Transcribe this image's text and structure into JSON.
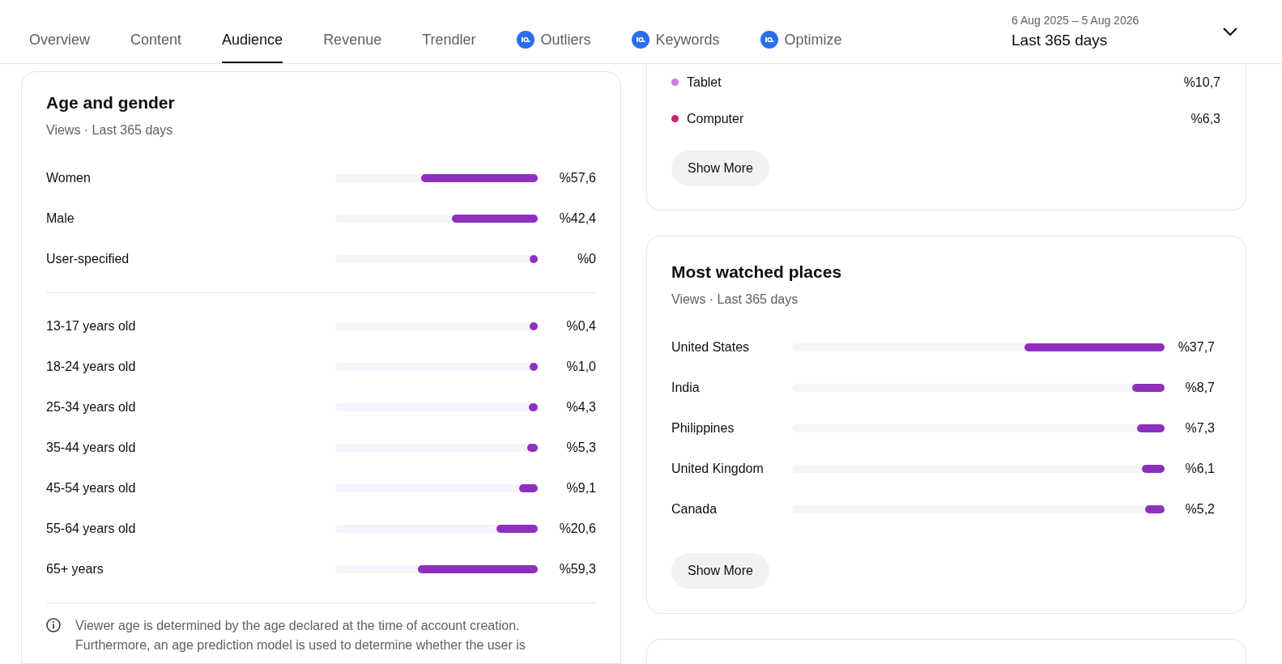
{
  "tabs": [
    {
      "label": "Overview",
      "selected": false,
      "kind": "plain"
    },
    {
      "label": "Content",
      "selected": false,
      "kind": "plain"
    },
    {
      "label": "Audience",
      "selected": true,
      "kind": "plain"
    },
    {
      "label": "Revenue",
      "selected": false,
      "kind": "plain"
    },
    {
      "label": "Trendler",
      "selected": false,
      "kind": "plain"
    },
    {
      "label": "Outliers",
      "selected": false,
      "kind": "tool"
    },
    {
      "label": "Keywords",
      "selected": false,
      "kind": "tool"
    },
    {
      "label": "Optimize",
      "selected": false,
      "kind": "tool"
    }
  ],
  "date_range": {
    "range": "6 Aug 2025 – 5 Aug 2026",
    "period": "Last 365 days"
  },
  "age_gender": {
    "title": "Age and gender",
    "subtitle": "Views · Last 365 days",
    "gender_rows": [
      {
        "label": "Women",
        "level": 0.576,
        "value": "%57,6"
      },
      {
        "label": "Male",
        "level": 0.424,
        "value": "%42,4"
      },
      {
        "label": "User-specified",
        "level": 0,
        "value": "%0"
      }
    ],
    "age_rows": [
      {
        "label": "13-17 years old",
        "level": 0.004,
        "value": "%0,4"
      },
      {
        "label": "18-24 years old",
        "level": 0.01,
        "value": "%1,0"
      },
      {
        "label": "25-34 years old",
        "level": 0.043,
        "value": "%4,3"
      },
      {
        "label": "35-44 years old",
        "level": 0.053,
        "value": "%5,3"
      },
      {
        "label": "45-54 years old",
        "level": 0.091,
        "value": "%9,1"
      },
      {
        "label": "55-64 years old",
        "level": 0.206,
        "value": "%20,6"
      },
      {
        "label": "65+ years",
        "level": 0.593,
        "value": "%59,3"
      }
    ],
    "note": "Viewer age is determined by the age declared at the time of account creation. Furthermore, an age prediction model is used to determine whether the user is"
  },
  "devices": {
    "rows": [
      {
        "label": "Tablet",
        "value": "%10,7",
        "color": "#c47fe8"
      },
      {
        "label": "Computer",
        "value": "%6,3",
        "color": "#c2266a"
      }
    ],
    "button": "Show More"
  },
  "places": {
    "title": "Most watched places",
    "subtitle": "Views · Last 365 days",
    "rows": [
      {
        "label": "United States",
        "level": 0.377,
        "value": "%37,7"
      },
      {
        "label": "India",
        "level": 0.087,
        "value": "%8,7"
      },
      {
        "label": "Philippines",
        "level": 0.073,
        "value": "%7,3"
      },
      {
        "label": "United Kingdom",
        "level": 0.061,
        "value": "%6,1"
      },
      {
        "label": "Canada",
        "level": 0.052,
        "value": "%5,2"
      }
    ],
    "button": "Show More"
  }
}
